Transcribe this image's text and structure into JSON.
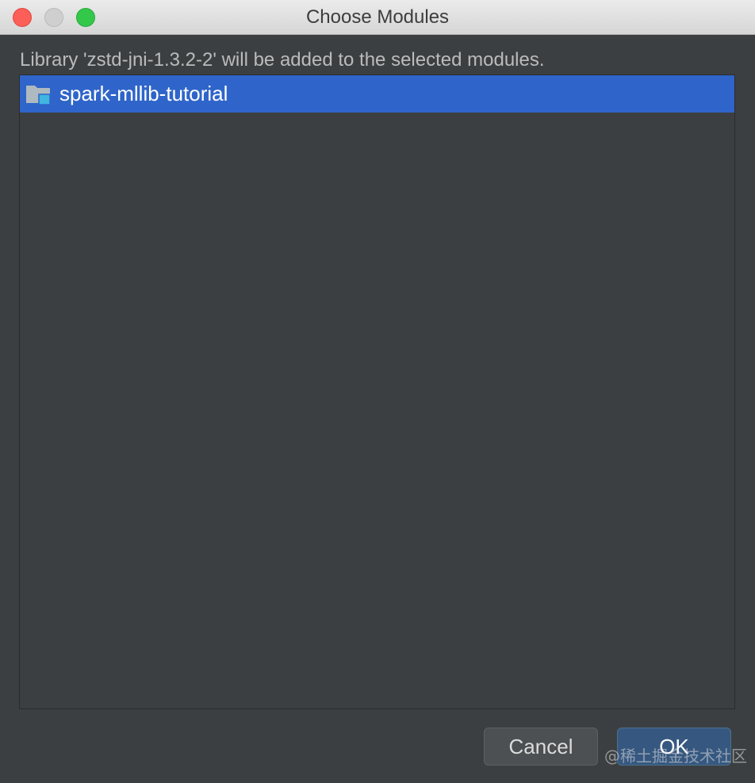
{
  "window": {
    "title": "Choose Modules"
  },
  "message": "Library 'zstd-jni-1.3.2-2' will be added to the selected modules.",
  "modules": [
    {
      "label": "spark-mllib-tutorial",
      "icon": "module-folder-icon",
      "selected": true
    }
  ],
  "buttons": {
    "cancel": "Cancel",
    "ok": "OK"
  },
  "watermark": "@稀土掘金技术社区",
  "colors": {
    "background": "#3c3f41",
    "selection": "#2f65ca",
    "default_button": "#365880"
  }
}
